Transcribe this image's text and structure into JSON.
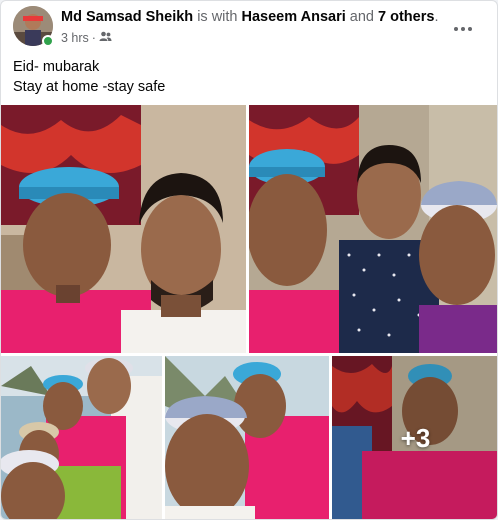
{
  "post": {
    "author": "Md Samsad Sheikh",
    "with_text": "is with",
    "tagged_person": "Haseem Ansari",
    "and_text": "and",
    "others": "7 others",
    "period": ".",
    "time": "3 hrs",
    "separator": "·",
    "audience_icon": "friends-icon",
    "more_icon": "ellipsis-icon",
    "text_line1": "Eid- mubarak",
    "text_line2": "Stay at home -stay safe"
  },
  "photos": {
    "more_count": "+3"
  },
  "colors": {
    "online": "#31a24c",
    "name": "#050505",
    "meta": "#65676b",
    "pink_shirt": "#e61e74",
    "cap_blue": "#3aa8d8"
  }
}
